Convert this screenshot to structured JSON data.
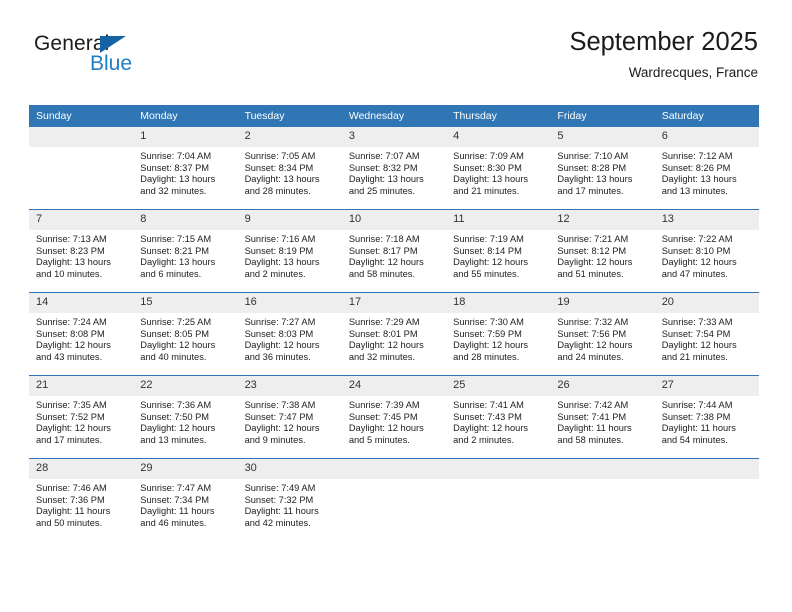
{
  "brand": {
    "name_top": "General",
    "name_bottom": "Blue",
    "triangle_color": "#1464a5",
    "blue_text_color": "#1f7fc4"
  },
  "header": {
    "title": "September 2025",
    "subtitle": "Wardrecques, France"
  },
  "theme": {
    "header_row_bg": "#3076b5",
    "daynum_bg": "#eeeeee",
    "row_divider": "#3076b5",
    "text": "#222222"
  },
  "calendar": {
    "weekday_headers": [
      "Sunday",
      "Monday",
      "Tuesday",
      "Wednesday",
      "Thursday",
      "Friday",
      "Saturday"
    ],
    "weeks": [
      [
        {
          "day": "",
          "sunrise": "",
          "sunset": "",
          "daylight_line1": "",
          "daylight_line2": ""
        },
        {
          "day": "1",
          "sunrise": "Sunrise: 7:04 AM",
          "sunset": "Sunset: 8:37 PM",
          "daylight_line1": "Daylight: 13 hours",
          "daylight_line2": "and 32 minutes."
        },
        {
          "day": "2",
          "sunrise": "Sunrise: 7:05 AM",
          "sunset": "Sunset: 8:34 PM",
          "daylight_line1": "Daylight: 13 hours",
          "daylight_line2": "and 28 minutes."
        },
        {
          "day": "3",
          "sunrise": "Sunrise: 7:07 AM",
          "sunset": "Sunset: 8:32 PM",
          "daylight_line1": "Daylight: 13 hours",
          "daylight_line2": "and 25 minutes."
        },
        {
          "day": "4",
          "sunrise": "Sunrise: 7:09 AM",
          "sunset": "Sunset: 8:30 PM",
          "daylight_line1": "Daylight: 13 hours",
          "daylight_line2": "and 21 minutes."
        },
        {
          "day": "5",
          "sunrise": "Sunrise: 7:10 AM",
          "sunset": "Sunset: 8:28 PM",
          "daylight_line1": "Daylight: 13 hours",
          "daylight_line2": "and 17 minutes."
        },
        {
          "day": "6",
          "sunrise": "Sunrise: 7:12 AM",
          "sunset": "Sunset: 8:26 PM",
          "daylight_line1": "Daylight: 13 hours",
          "daylight_line2": "and 13 minutes."
        }
      ],
      [
        {
          "day": "7",
          "sunrise": "Sunrise: 7:13 AM",
          "sunset": "Sunset: 8:23 PM",
          "daylight_line1": "Daylight: 13 hours",
          "daylight_line2": "and 10 minutes."
        },
        {
          "day": "8",
          "sunrise": "Sunrise: 7:15 AM",
          "sunset": "Sunset: 8:21 PM",
          "daylight_line1": "Daylight: 13 hours",
          "daylight_line2": "and 6 minutes."
        },
        {
          "day": "9",
          "sunrise": "Sunrise: 7:16 AM",
          "sunset": "Sunset: 8:19 PM",
          "daylight_line1": "Daylight: 13 hours",
          "daylight_line2": "and 2 minutes."
        },
        {
          "day": "10",
          "sunrise": "Sunrise: 7:18 AM",
          "sunset": "Sunset: 8:17 PM",
          "daylight_line1": "Daylight: 12 hours",
          "daylight_line2": "and 58 minutes."
        },
        {
          "day": "11",
          "sunrise": "Sunrise: 7:19 AM",
          "sunset": "Sunset: 8:14 PM",
          "daylight_line1": "Daylight: 12 hours",
          "daylight_line2": "and 55 minutes."
        },
        {
          "day": "12",
          "sunrise": "Sunrise: 7:21 AM",
          "sunset": "Sunset: 8:12 PM",
          "daylight_line1": "Daylight: 12 hours",
          "daylight_line2": "and 51 minutes."
        },
        {
          "day": "13",
          "sunrise": "Sunrise: 7:22 AM",
          "sunset": "Sunset: 8:10 PM",
          "daylight_line1": "Daylight: 12 hours",
          "daylight_line2": "and 47 minutes."
        }
      ],
      [
        {
          "day": "14",
          "sunrise": "Sunrise: 7:24 AM",
          "sunset": "Sunset: 8:08 PM",
          "daylight_line1": "Daylight: 12 hours",
          "daylight_line2": "and 43 minutes."
        },
        {
          "day": "15",
          "sunrise": "Sunrise: 7:25 AM",
          "sunset": "Sunset: 8:05 PM",
          "daylight_line1": "Daylight: 12 hours",
          "daylight_line2": "and 40 minutes."
        },
        {
          "day": "16",
          "sunrise": "Sunrise: 7:27 AM",
          "sunset": "Sunset: 8:03 PM",
          "daylight_line1": "Daylight: 12 hours",
          "daylight_line2": "and 36 minutes."
        },
        {
          "day": "17",
          "sunrise": "Sunrise: 7:29 AM",
          "sunset": "Sunset: 8:01 PM",
          "daylight_line1": "Daylight: 12 hours",
          "daylight_line2": "and 32 minutes."
        },
        {
          "day": "18",
          "sunrise": "Sunrise: 7:30 AM",
          "sunset": "Sunset: 7:59 PM",
          "daylight_line1": "Daylight: 12 hours",
          "daylight_line2": "and 28 minutes."
        },
        {
          "day": "19",
          "sunrise": "Sunrise: 7:32 AM",
          "sunset": "Sunset: 7:56 PM",
          "daylight_line1": "Daylight: 12 hours",
          "daylight_line2": "and 24 minutes."
        },
        {
          "day": "20",
          "sunrise": "Sunrise: 7:33 AM",
          "sunset": "Sunset: 7:54 PM",
          "daylight_line1": "Daylight: 12 hours",
          "daylight_line2": "and 21 minutes."
        }
      ],
      [
        {
          "day": "21",
          "sunrise": "Sunrise: 7:35 AM",
          "sunset": "Sunset: 7:52 PM",
          "daylight_line1": "Daylight: 12 hours",
          "daylight_line2": "and 17 minutes."
        },
        {
          "day": "22",
          "sunrise": "Sunrise: 7:36 AM",
          "sunset": "Sunset: 7:50 PM",
          "daylight_line1": "Daylight: 12 hours",
          "daylight_line2": "and 13 minutes."
        },
        {
          "day": "23",
          "sunrise": "Sunrise: 7:38 AM",
          "sunset": "Sunset: 7:47 PM",
          "daylight_line1": "Daylight: 12 hours",
          "daylight_line2": "and 9 minutes."
        },
        {
          "day": "24",
          "sunrise": "Sunrise: 7:39 AM",
          "sunset": "Sunset: 7:45 PM",
          "daylight_line1": "Daylight: 12 hours",
          "daylight_line2": "and 5 minutes."
        },
        {
          "day": "25",
          "sunrise": "Sunrise: 7:41 AM",
          "sunset": "Sunset: 7:43 PM",
          "daylight_line1": "Daylight: 12 hours",
          "daylight_line2": "and 2 minutes."
        },
        {
          "day": "26",
          "sunrise": "Sunrise: 7:42 AM",
          "sunset": "Sunset: 7:41 PM",
          "daylight_line1": "Daylight: 11 hours",
          "daylight_line2": "and 58 minutes."
        },
        {
          "day": "27",
          "sunrise": "Sunrise: 7:44 AM",
          "sunset": "Sunset: 7:38 PM",
          "daylight_line1": "Daylight: 11 hours",
          "daylight_line2": "and 54 minutes."
        }
      ],
      [
        {
          "day": "28",
          "sunrise": "Sunrise: 7:46 AM",
          "sunset": "Sunset: 7:36 PM",
          "daylight_line1": "Daylight: 11 hours",
          "daylight_line2": "and 50 minutes."
        },
        {
          "day": "29",
          "sunrise": "Sunrise: 7:47 AM",
          "sunset": "Sunset: 7:34 PM",
          "daylight_line1": "Daylight: 11 hours",
          "daylight_line2": "and 46 minutes."
        },
        {
          "day": "30",
          "sunrise": "Sunrise: 7:49 AM",
          "sunset": "Sunset: 7:32 PM",
          "daylight_line1": "Daylight: 11 hours",
          "daylight_line2": "and 42 minutes."
        },
        {
          "day": "",
          "sunrise": "",
          "sunset": "",
          "daylight_line1": "",
          "daylight_line2": ""
        },
        {
          "day": "",
          "sunrise": "",
          "sunset": "",
          "daylight_line1": "",
          "daylight_line2": ""
        },
        {
          "day": "",
          "sunrise": "",
          "sunset": "",
          "daylight_line1": "",
          "daylight_line2": ""
        },
        {
          "day": "",
          "sunrise": "",
          "sunset": "",
          "daylight_line1": "",
          "daylight_line2": ""
        }
      ]
    ]
  }
}
